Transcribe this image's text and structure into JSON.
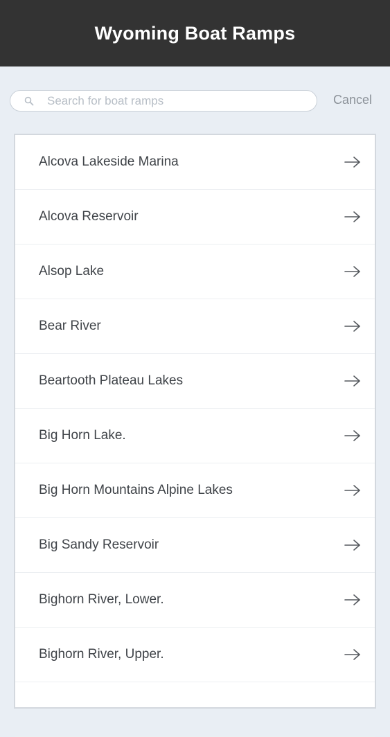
{
  "header": {
    "title": "Wyoming Boat Ramps"
  },
  "search": {
    "placeholder": "Search for boat ramps",
    "value": "",
    "cancel_label": "Cancel",
    "icon": "search-icon"
  },
  "list": {
    "item_icon": "arrow-right-icon",
    "items": [
      {
        "label": "Alcova Lakeside Marina"
      },
      {
        "label": "Alcova Reservoir"
      },
      {
        "label": "Alsop Lake"
      },
      {
        "label": "Bear River"
      },
      {
        "label": "Beartooth Plateau Lakes"
      },
      {
        "label": "Big Horn Lake."
      },
      {
        "label": "Big Horn Mountains Alpine Lakes"
      },
      {
        "label": "Big Sandy Reservoir"
      },
      {
        "label": "Bighorn River, Lower."
      },
      {
        "label": "Bighorn River, Upper."
      },
      {
        "label": ""
      }
    ]
  },
  "colors": {
    "header_bg": "#333333",
    "page_bg": "#e9eef4",
    "list_bg": "#ffffff",
    "text": "#3f4348",
    "placeholder": "#b7bec6",
    "cancel": "#8c9299"
  }
}
